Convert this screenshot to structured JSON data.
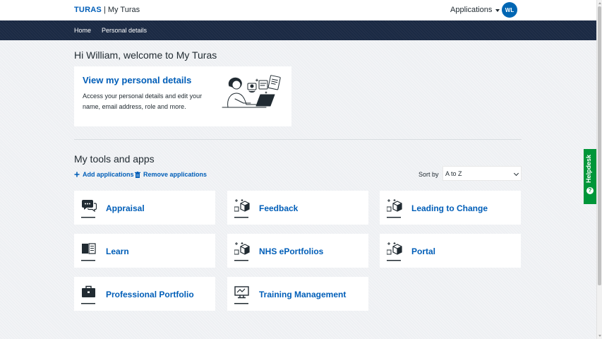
{
  "header": {
    "brand": "TURAS",
    "separator": "|",
    "subtitle": "My Turas",
    "applications_label": "Applications",
    "avatar_initials": "WL"
  },
  "nav": {
    "items": [
      {
        "label": "Home"
      },
      {
        "label": "Personal details"
      }
    ]
  },
  "welcome": "Hi William, welcome to My Turas",
  "details_card": {
    "title": "View my personal details",
    "description": "Access your personal details and edit your name, email address, role and more."
  },
  "tools": {
    "title": "My tools and apps",
    "add_label": "Add applications",
    "remove_label": "Remove applications",
    "sort_label": "Sort by",
    "sort_value": "A to Z",
    "tiles": [
      {
        "label": "Appraisal",
        "icon": "speech-bubbles-icon"
      },
      {
        "label": "Feedback",
        "icon": "box-stars-icon"
      },
      {
        "label": "Leading to Change",
        "icon": "box-stars-icon"
      },
      {
        "label": "Learn",
        "icon": "book-icon"
      },
      {
        "label": "NHS ePortfolios",
        "icon": "box-stars-icon"
      },
      {
        "label": "Portal",
        "icon": "box-stars-icon"
      },
      {
        "label": "Professional Portfolio",
        "icon": "briefcase-icon"
      },
      {
        "label": "Training Management",
        "icon": "monitor-icon"
      }
    ]
  },
  "helpdesk": {
    "label": "Helpdesk"
  },
  "colors": {
    "brand_blue": "#005eb8",
    "nav_dark": "#1b2a44",
    "helpdesk_green": "#009639"
  }
}
